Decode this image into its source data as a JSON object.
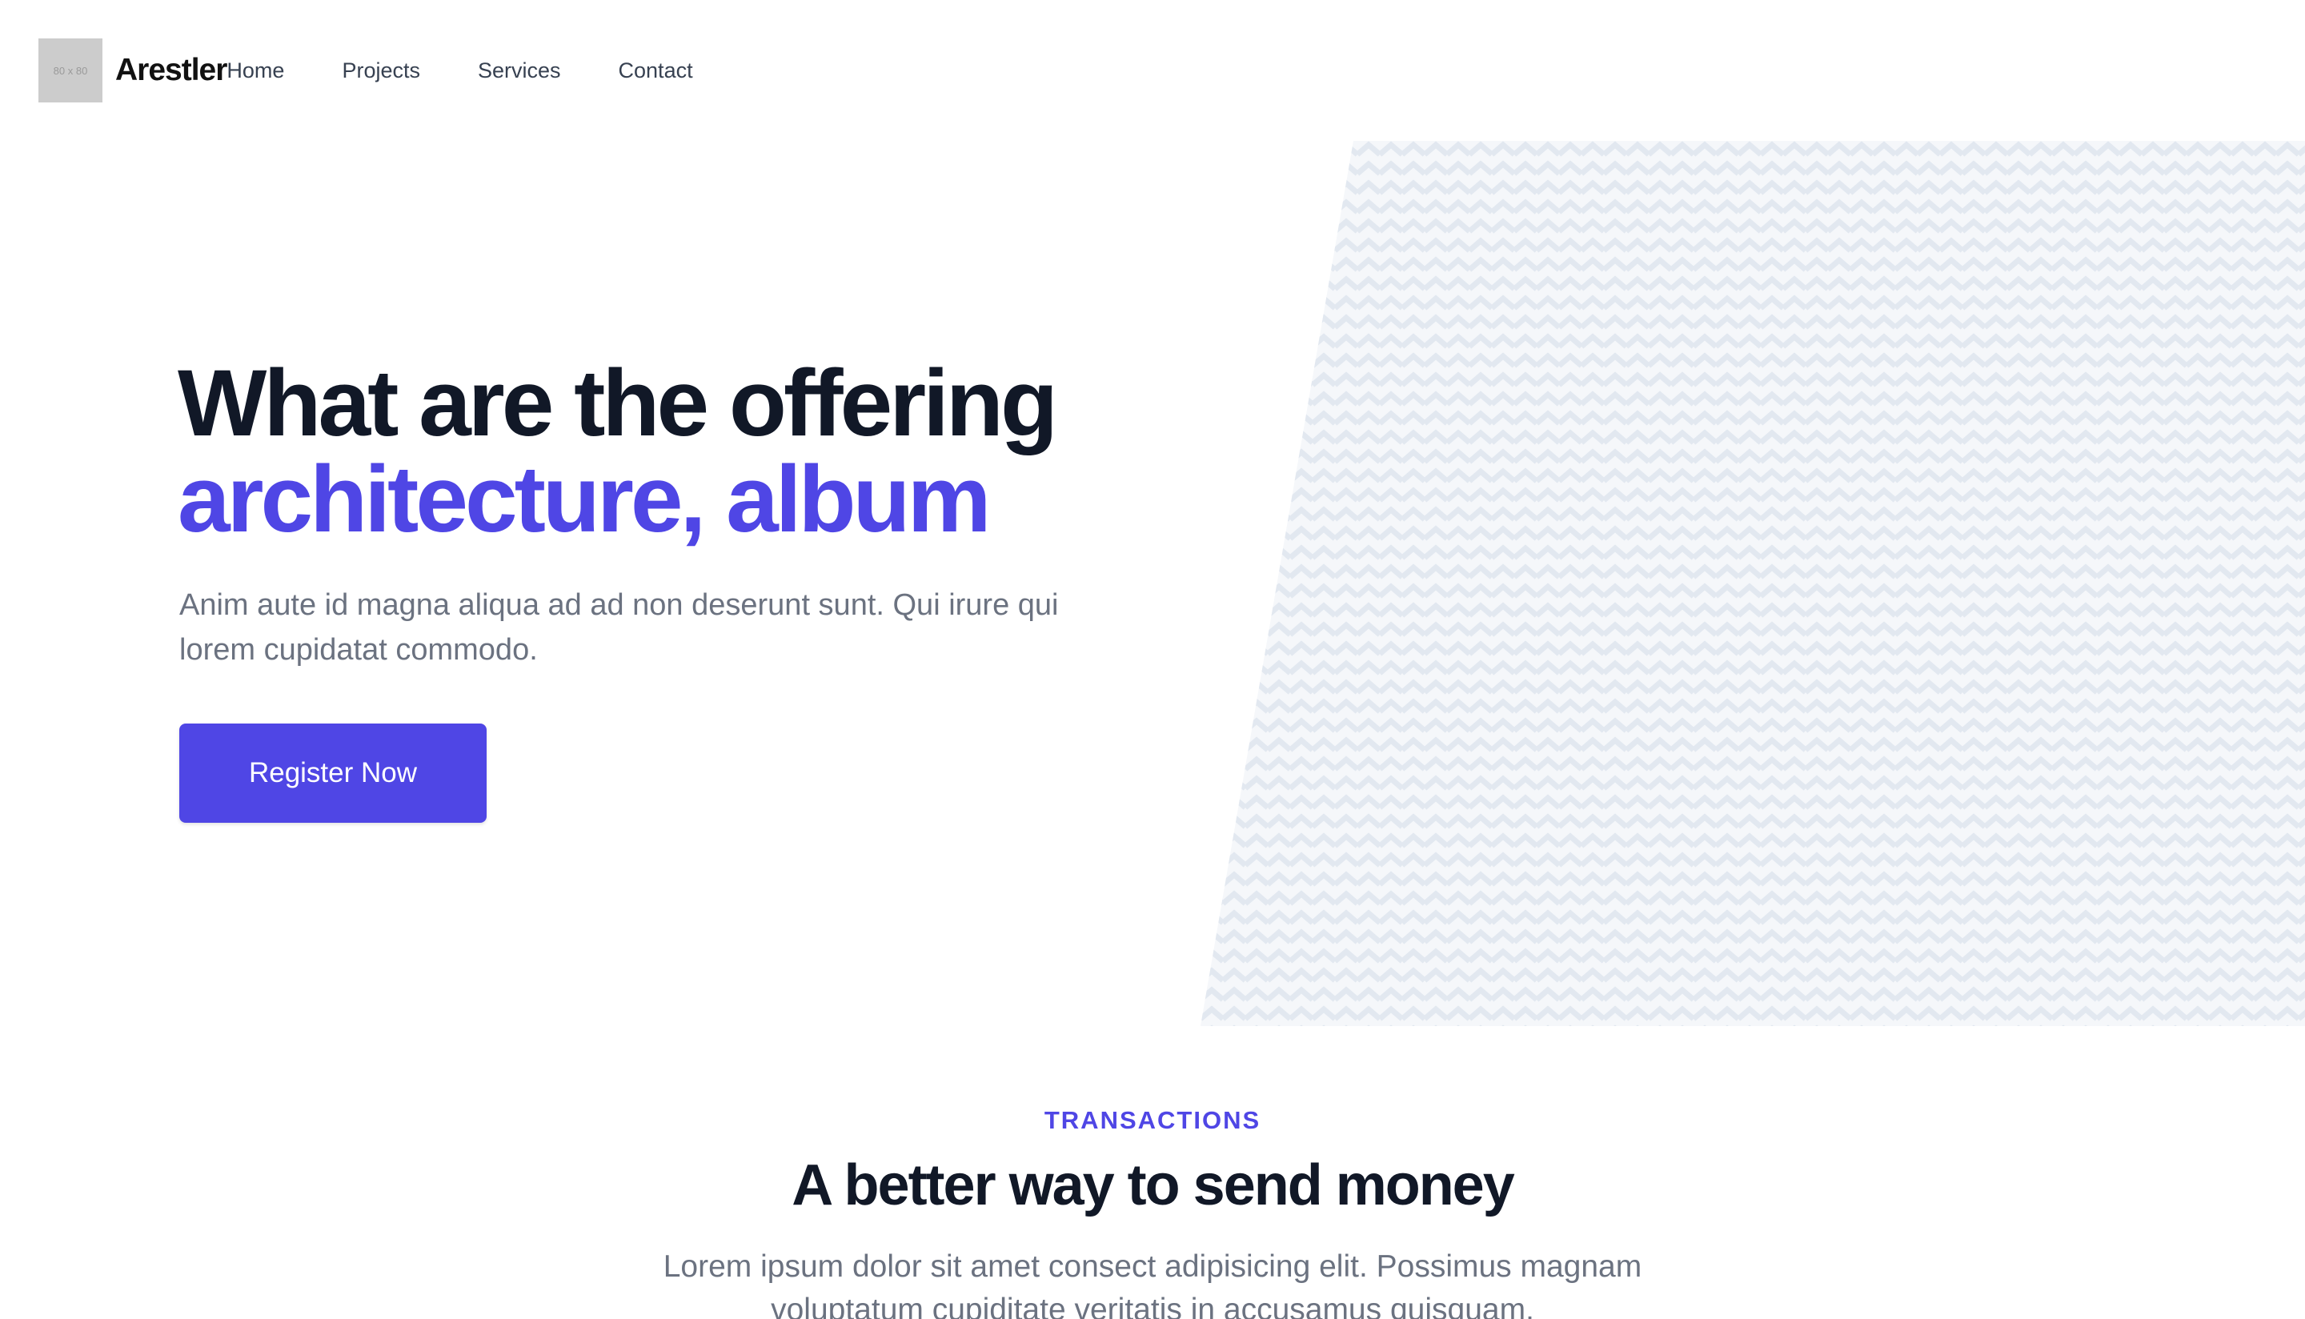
{
  "nav": {
    "logo_text": "80 x 80",
    "brand": "Arestler",
    "links": [
      "Home",
      "Projects",
      "Services",
      "Contact"
    ]
  },
  "hero": {
    "title_line1": "What are the offering",
    "title_line2": "architecture, album",
    "subtitle": "Anim aute id magna aliqua ad ad non deserunt sunt. Qui irure qui lorem cupidatat commodo.",
    "button_label": "Register Now",
    "pattern": "chevron-zigzag"
  },
  "section": {
    "label": "TRANSACTIONS",
    "title": "A better way to send money",
    "text": "Lorem ipsum dolor sit amet consect adipisicing elit. Possimus magnam voluptatum cupiditate veritatis in accusamus quisquam."
  },
  "colors": {
    "accent": "#4f46e5",
    "heading": "#111827",
    "body": "#6b7280",
    "pattern": "#e2e8f0"
  }
}
